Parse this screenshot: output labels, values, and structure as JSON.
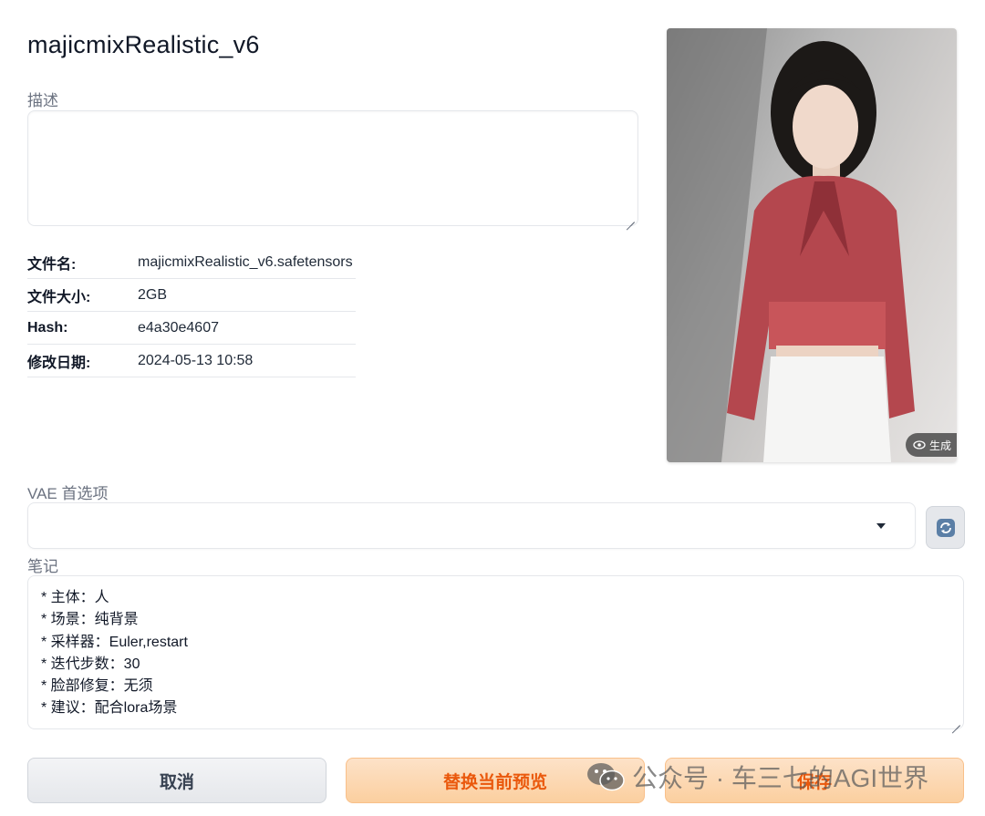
{
  "model": {
    "title": "majicmixRealistic_v6"
  },
  "description": {
    "label": "描述",
    "value": ""
  },
  "info": [
    {
      "key": "文件名:",
      "value": "majicmixRealistic_v6.safetensors"
    },
    {
      "key": "文件大小:",
      "value": "2GB"
    },
    {
      "key": "Hash:",
      "value": "e4a30e4607"
    },
    {
      "key": "修改日期:",
      "value": "2024-05-13 10:58"
    }
  ],
  "preview": {
    "badge_icon": "eye-icon",
    "badge_text": "生成"
  },
  "vae": {
    "label": "VAE 首选项",
    "selected": ""
  },
  "notes": {
    "label": "笔记",
    "lines": [
      "* 主体：人",
      "* 场景：纯背景",
      "* 采样器：Euler,restart",
      "* 迭代步数：30",
      "* 脸部修复：无须",
      "* 建议：配合lora场景"
    ]
  },
  "buttons": {
    "cancel": "取消",
    "replace_preview": "替换当前预览",
    "save": "保存"
  },
  "watermark": {
    "text": "公众号 · 车三七的AGI世界",
    "icon": "wechat-icon"
  },
  "colors": {
    "accent": "#ea580c",
    "primary_bg": "#fbcf9f"
  }
}
